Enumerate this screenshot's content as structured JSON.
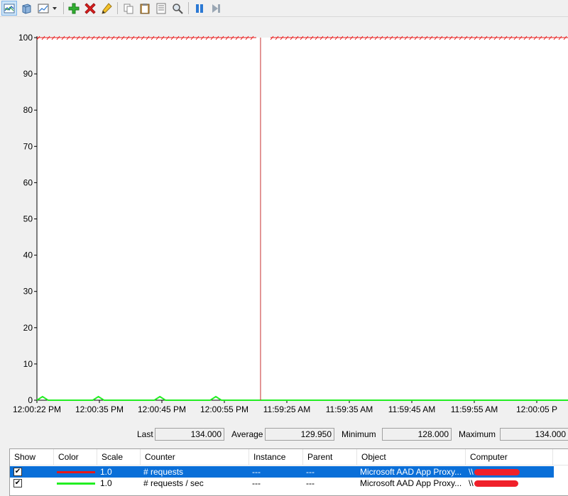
{
  "colors": {
    "series_requests": "#e81818",
    "series_requests_per_sec": "#22ee22",
    "time_bar": "#c83030",
    "selection": "#0a6fd8"
  },
  "toolbar": {
    "buttons": [
      {
        "name": "view-graph-button",
        "icon": "line-graph-icon",
        "active": true
      },
      {
        "name": "view-histogram-button",
        "icon": "histogram-icon"
      },
      {
        "name": "change-graph-type-button",
        "icon": "graph-type-icon"
      },
      {
        "name": "graph-type-dropdown",
        "icon": "chevron-down-icon"
      },
      {
        "name": "add-counter-button",
        "icon": "plus-icon"
      },
      {
        "name": "delete-counter-button",
        "icon": "delete-x-icon"
      },
      {
        "name": "highlight-button",
        "icon": "pencil-icon"
      },
      {
        "name": "copy-properties-button",
        "icon": "copy-icon"
      },
      {
        "name": "paste-counter-list-button",
        "icon": "clipboard-icon"
      },
      {
        "name": "properties-button",
        "icon": "properties-icon"
      },
      {
        "name": "zoom-button",
        "icon": "magnifier-icon"
      },
      {
        "name": "freeze-display-button",
        "icon": "pause-icon"
      },
      {
        "name": "update-data-button",
        "icon": "step-forward-icon"
      }
    ]
  },
  "chart_data": {
    "type": "line",
    "ylim": [
      0,
      100
    ],
    "y_ticks": [
      "100",
      "90",
      "80",
      "70",
      "60",
      "50",
      "40",
      "30",
      "20",
      "10",
      "0"
    ],
    "x_ticks": [
      "12:00:22 PM",
      "12:00:35 PM",
      "12:00:45 PM",
      "12:00:55 PM",
      "11:59:25 AM",
      "11:59:35 AM",
      "11:59:45 AM",
      "11:59:55 AM",
      "12:00:05 P"
    ],
    "samples": 96,
    "current_sample_index": 40,
    "grid": false,
    "legend": "bottom",
    "series": [
      {
        "name": "# requests",
        "color": "#e81818",
        "values_clipped_at_top": true,
        "value": 100
      },
      {
        "name": "# requests / sec",
        "color": "#22ee22",
        "spike_sample_indices": [
          1,
          11,
          22,
          32
        ],
        "spike_value": 1,
        "base_value": 0
      }
    ]
  },
  "stats": {
    "last_label": "Last",
    "last_value": "134.000",
    "average_label": "Average",
    "average_value": "129.950",
    "minimum_label": "Minimum",
    "minimum_value": "128.000",
    "maximum_label": "Maximum",
    "maximum_value": "134.000"
  },
  "legend": {
    "headers": {
      "show": "Show",
      "color": "Color",
      "scale": "Scale",
      "counter": "Counter",
      "instance": "Instance",
      "parent": "Parent",
      "object": "Object",
      "computer": "Computer"
    },
    "rows": [
      {
        "show": "✔",
        "scale": "1.0",
        "counter": "# requests",
        "instance": "---",
        "parent": "---",
        "object": "Microsoft AAD App Proxy...",
        "computer": "\\\\",
        "selected": true
      },
      {
        "show": "✔",
        "scale": "1.0",
        "counter": "# requests / sec",
        "instance": "---",
        "parent": "---",
        "object": "Microsoft AAD App Proxy...",
        "computer": "\\\\",
        "selected": false
      }
    ]
  }
}
